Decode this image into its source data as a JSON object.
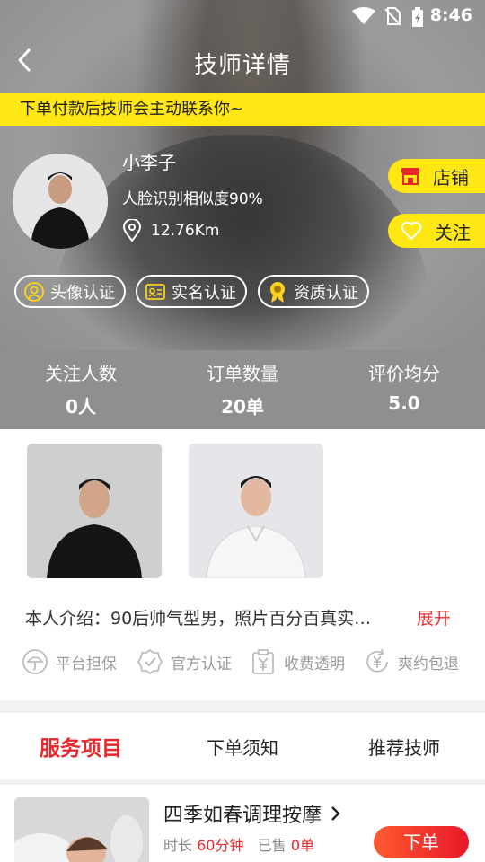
{
  "status_bar": {
    "time": "8:46"
  },
  "header": {
    "title": "技师详情"
  },
  "notice": "下单付款后技师会主动联系你~",
  "profile": {
    "name": "小李子",
    "face_match": "人脸识别相似度90%",
    "distance": "12.76Km"
  },
  "side_buttons": {
    "shop": "店铺",
    "follow": "关注"
  },
  "certs": [
    "头像认证",
    "实名认证",
    "资质认证"
  ],
  "stats": [
    {
      "label": "关注人数",
      "value": "0人"
    },
    {
      "label": "订单数量",
      "value": "20单"
    },
    {
      "label": "评价均分",
      "value": "5.0"
    }
  ],
  "intro": {
    "text": "本人介绍：90后帅气型男，照片百分百真实…",
    "expand": "展开"
  },
  "guarantees": [
    "平台担保",
    "官方认证",
    "收费透明",
    "爽约包退"
  ],
  "tabs": [
    "服务项目",
    "下单须知",
    "推荐技师"
  ],
  "service": {
    "name": "四季如春调理按摩",
    "duration_label": "时长",
    "duration": "60分钟",
    "sold_label": "已售",
    "sold": "0单",
    "order_button": "下单"
  },
  "colors": {
    "accent_yellow": "#ffe713",
    "accent_red": "#e8262b"
  }
}
